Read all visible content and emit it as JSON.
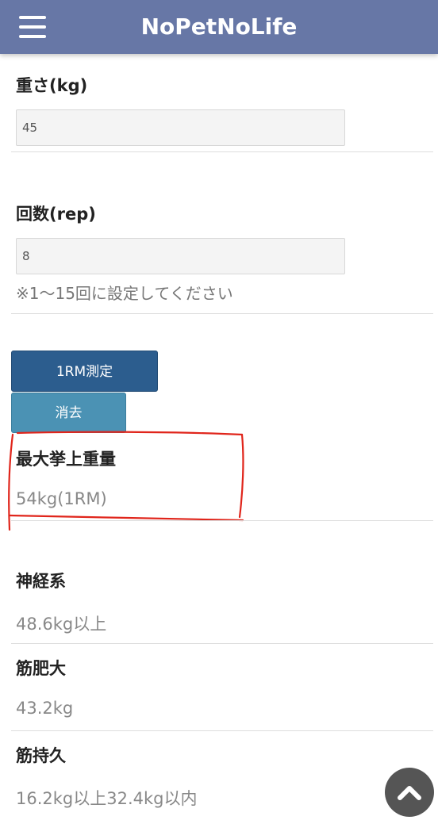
{
  "header": {
    "title": "NoPetNoLife",
    "bg_color": "#6777a6"
  },
  "weight": {
    "label": "重さ(kg)",
    "value": "45"
  },
  "reps": {
    "label": "回数(rep)",
    "value": "8",
    "note": "※1〜15回に設定してください"
  },
  "buttons": {
    "measure_label": "1RM測定",
    "clear_label": "消去"
  },
  "results": {
    "max_label": "最大挙上重量",
    "max_value": "54kg(1RM)",
    "neural_label": "神経系",
    "neural_value": "48.6kg以上",
    "hypertrophy_label": "筋肥大",
    "hypertrophy_value": "43.2kg",
    "endurance_label": "筋持久",
    "endurance_value": "16.2kg以上32.4kg以内"
  },
  "icons": {
    "menu": "hamburger-menu-icon",
    "scroll_top": "chevron-up-icon"
  }
}
